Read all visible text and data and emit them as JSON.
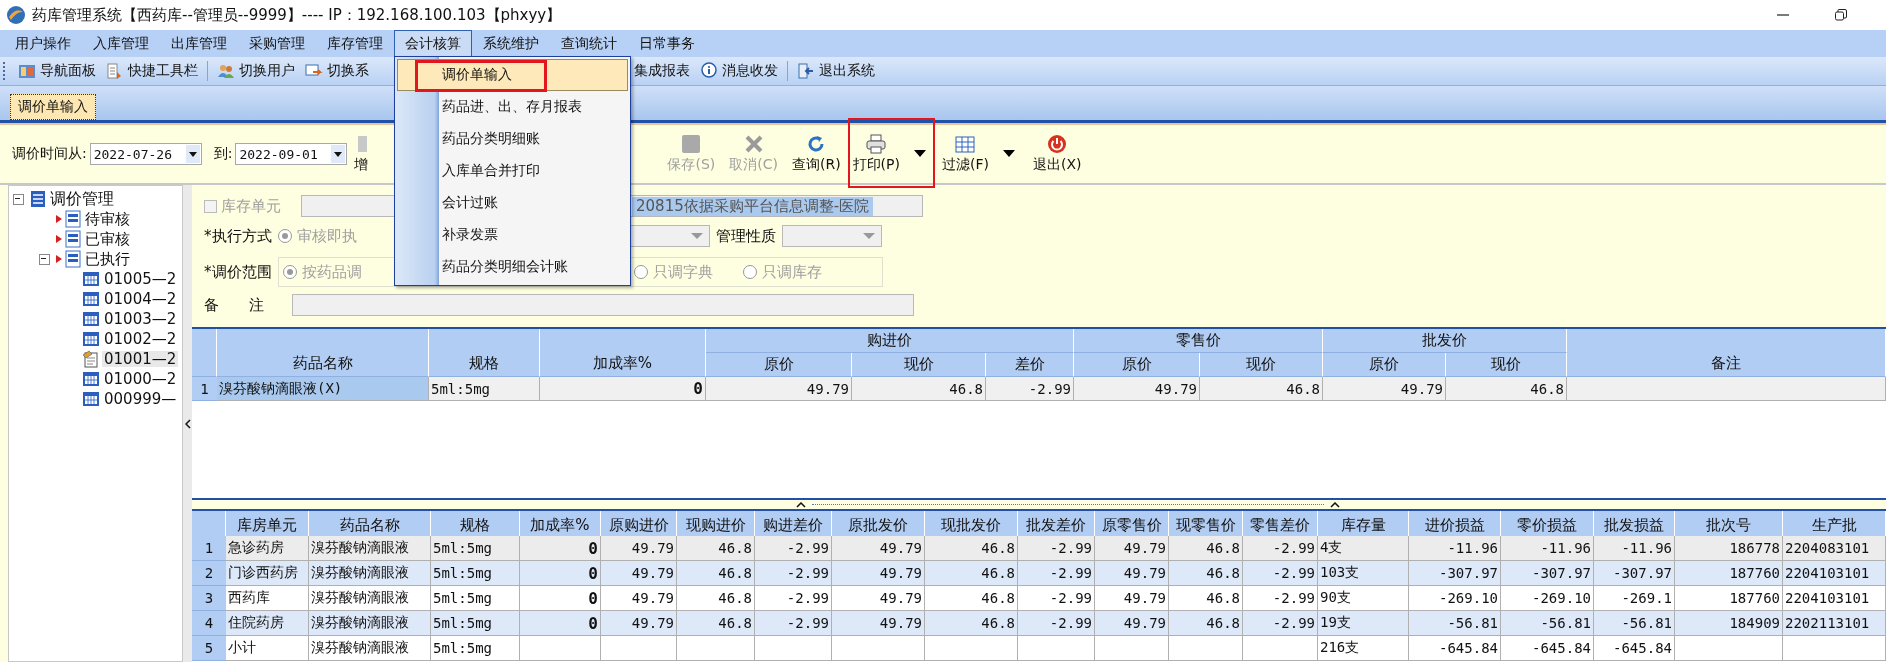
{
  "window": {
    "title": "药库管理系统【西药库--管理员--9999】---- IP：192.168.100.103【phxyy】"
  },
  "menu_bar": [
    {
      "label": "用户操作",
      "selected": false
    },
    {
      "label": "入库管理",
      "selected": false
    },
    {
      "label": "出库管理",
      "selected": false
    },
    {
      "label": "采购管理",
      "selected": false
    },
    {
      "label": "库存管理",
      "selected": false
    },
    {
      "label": "会计核算",
      "selected": true
    },
    {
      "label": "系统维护",
      "selected": false
    },
    {
      "label": "查询统计",
      "selected": false
    },
    {
      "label": "日常事务",
      "selected": false
    }
  ],
  "dropdown_menu": {
    "items": [
      {
        "label": "调价单输入",
        "selected": true,
        "framed": true
      },
      {
        "label": "药品进、出、存月报表",
        "selected": false,
        "framed": false
      },
      {
        "label": "药品分类明细账",
        "selected": false,
        "framed": false
      },
      {
        "label": "入库单合并打印",
        "selected": false,
        "framed": false
      },
      {
        "label": "会计过账",
        "selected": false,
        "framed": false
      },
      {
        "label": "补录发票",
        "selected": false,
        "framed": false
      },
      {
        "label": "药品分类明细会计账",
        "selected": false,
        "framed": false
      }
    ]
  },
  "toolbar": [
    {
      "label": "导航面板"
    },
    {
      "label": "快捷工具栏"
    },
    {
      "label": "切换用户"
    },
    {
      "label": "切换系"
    },
    {
      "label": "集成报表"
    },
    {
      "label": "消息收发"
    },
    {
      "label": "退出系统"
    }
  ],
  "tabs": [
    {
      "label": "调价单输入",
      "selected": true
    }
  ],
  "filter": {
    "from_label": "调价时间从:",
    "from": "2022-07-26",
    "to_label": "到:",
    "to": "2022-09-01"
  },
  "actions": [
    {
      "label": "增",
      "disabled": false,
      "dropdown": false,
      "framed": false
    },
    {
      "label": "保存(S)",
      "disabled": true,
      "dropdown": false,
      "framed": false
    },
    {
      "label": "取消(C)",
      "disabled": true,
      "dropdown": false,
      "framed": false
    },
    {
      "label": "查询(R)",
      "disabled": false,
      "dropdown": false,
      "framed": false
    },
    {
      "label": "打印(P)",
      "disabled": false,
      "dropdown": true,
      "framed": true
    },
    {
      "label": "过滤(F)",
      "disabled": false,
      "dropdown": true,
      "framed": false
    },
    {
      "label": "退出(X)",
      "disabled": false,
      "dropdown": false,
      "framed": false
    }
  ],
  "tree": [
    {
      "label": "调价管理",
      "kind": "root",
      "selected": false,
      "expanded": true,
      "children": [
        {
          "label": "待审核",
          "kind": "status",
          "selected": false
        },
        {
          "label": "已审核",
          "kind": "status",
          "selected": false
        },
        {
          "label": "已执行",
          "kind": "status",
          "selected": false,
          "expanded": true,
          "children": [
            {
              "label": "01005—2",
              "kind": "record",
              "selected": false
            },
            {
              "label": "01004—2",
              "kind": "record",
              "selected": false
            },
            {
              "label": "01003—2",
              "kind": "record",
              "selected": false
            },
            {
              "label": "01002—2",
              "kind": "record",
              "selected": false
            },
            {
              "label": "01001—2",
              "kind": "record",
              "selected": true
            },
            {
              "label": "01000—2",
              "kind": "record",
              "selected": false
            },
            {
              "label": "000999—",
              "kind": "record",
              "selected": false
            }
          ]
        }
      ]
    }
  ],
  "form": {
    "stock_unit": {
      "label": "库存单元",
      "checked": false,
      "disabled": true,
      "value": "20815依据采购平台信息调整-医院"
    },
    "exec_mode": {
      "label": "*执行方式",
      "option": "审核即执",
      "selected": true,
      "nature_label": "管理性质"
    },
    "scope": {
      "label": "*调价范围",
      "options": [
        {
          "label": "按药品调",
          "selected": true
        },
        {
          "label": "只调字典",
          "selected": false
        },
        {
          "label": "只调库存",
          "selected": false
        }
      ]
    },
    "remark": {
      "label": "备　　注"
    }
  },
  "price_table": {
    "group_headers": [
      {
        "label": "购进价"
      },
      {
        "label": "零售价"
      },
      {
        "label": "批发价"
      }
    ],
    "columns": [
      {
        "label": "药品名称"
      },
      {
        "label": "规格"
      },
      {
        "label": "加成率%"
      },
      {
        "label": "原价"
      },
      {
        "label": "现价"
      },
      {
        "label": "差价"
      },
      {
        "label": "原价"
      },
      {
        "label": "现价"
      },
      {
        "label": "原价"
      },
      {
        "label": "现价"
      },
      {
        "label": "备注"
      }
    ],
    "rows": [
      {
        "num": "1",
        "selected": true,
        "cells": [
          "溴芬酸钠滴眼液(X)",
          "5ml:5mg",
          "0",
          "49.79",
          "46.8",
          "-2.99",
          "49.79",
          "46.8",
          "49.79",
          "46.8",
          ""
        ]
      }
    ]
  },
  "stock_table": {
    "columns": [
      {
        "label": "库房单元"
      },
      {
        "label": "药品名称"
      },
      {
        "label": "规格"
      },
      {
        "label": "加成率%"
      },
      {
        "label": "原购进价"
      },
      {
        "label": "现购进价"
      },
      {
        "label": "购进差价"
      },
      {
        "label": "原批发价"
      },
      {
        "label": "现批发价"
      },
      {
        "label": "批发差价"
      },
      {
        "label": "原零售价"
      },
      {
        "label": "现零售价"
      },
      {
        "label": "零售差价"
      },
      {
        "label": "库存量"
      },
      {
        "label": "进价损益"
      },
      {
        "label": "零价损益"
      },
      {
        "label": "批发损益"
      },
      {
        "label": "批次号"
      },
      {
        "label": "生产批"
      }
    ],
    "rows": [
      {
        "num": "1",
        "selected": true,
        "cells": [
          "急诊药房",
          "溴芬酸钠滴眼液",
          "5ml:5mg",
          "0",
          "49.79",
          "46.8",
          "-2.99",
          "49.79",
          "46.8",
          "-2.99",
          "49.79",
          "46.8",
          "-2.99",
          "4支",
          "-11.96",
          "-11.96",
          "-11.96",
          "186778",
          "2204083101"
        ]
      },
      {
        "num": "2",
        "selected": false,
        "cells": [
          "门诊西药房",
          "溴芬酸钠滴眼液",
          "5ml:5mg",
          "0",
          "49.79",
          "46.8",
          "-2.99",
          "49.79",
          "46.8",
          "-2.99",
          "49.79",
          "46.8",
          "-2.99",
          "103支",
          "-307.97",
          "-307.97",
          "-307.97",
          "187760",
          "2204103101"
        ]
      },
      {
        "num": "3",
        "selected": false,
        "cells": [
          "西药库",
          "溴芬酸钠滴眼液",
          "5ml:5mg",
          "0",
          "49.79",
          "46.8",
          "-2.99",
          "49.79",
          "46.8",
          "-2.99",
          "49.79",
          "46.8",
          "-2.99",
          "90支",
          "-269.10",
          "-269.10",
          "-269.1",
          "187760",
          "2204103101"
        ]
      },
      {
        "num": "4",
        "selected": false,
        "cells": [
          "住院药房",
          "溴芬酸钠滴眼液",
          "5ml:5mg",
          "0",
          "49.79",
          "46.8",
          "-2.99",
          "49.79",
          "46.8",
          "-2.99",
          "49.79",
          "46.8",
          "-2.99",
          "19支",
          "-56.81",
          "-56.81",
          "-56.81",
          "184909",
          "2202113101"
        ]
      },
      {
        "num": "5",
        "selected": false,
        "cells": [
          "小计",
          "溴芬酸钠滴眼液",
          "5ml:5mg",
          "",
          "",
          "",
          "",
          "",
          "",
          "",
          "",
          "",
          "",
          "216支",
          "-645.84",
          "-645.84",
          "-645.84",
          "",
          ""
        ]
      }
    ]
  }
}
